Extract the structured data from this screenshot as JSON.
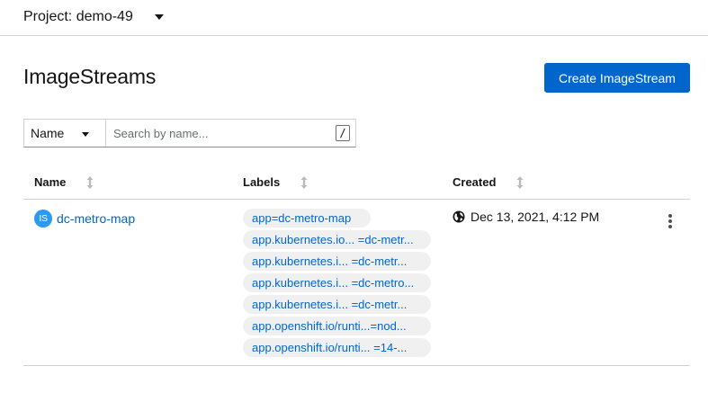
{
  "project": {
    "label": "Project: demo-49"
  },
  "page": {
    "title": "ImageStreams",
    "create_button": "Create ImageStream"
  },
  "filter": {
    "type_label": "Name",
    "placeholder": "Search by name...",
    "shortcut": "/"
  },
  "table": {
    "headers": {
      "name": "Name",
      "labels": "Labels",
      "created": "Created"
    },
    "rows": [
      {
        "badge": "IS",
        "name": "dc-metro-map",
        "labels": [
          "app=dc-metro-map",
          "app.kubernetes.io... =dc-metr...",
          "app.kubernetes.i...  =dc-metr...",
          "app.kubernetes.i... =dc-metro...",
          "app.kubernetes.i...  =dc-metr...",
          "app.openshift.io/runti...=nod...",
          "app.openshift.io/runti...  =14-..."
        ],
        "created": "Dec 13, 2021, 4:12 PM"
      }
    ]
  },
  "icons": {
    "project_caret": "caret-down-icon",
    "filter_caret": "caret-down-icon",
    "sort": "sort-icon",
    "badge": "imagestream-badge-icon",
    "created": "globe-icon",
    "actions": "kebab-icon"
  },
  "colors": {
    "primary": "#0066cc",
    "badge": "#2b9af3",
    "chip_bg": "#f0f0f0",
    "text": "#151515",
    "border": "#d2d2d2"
  }
}
